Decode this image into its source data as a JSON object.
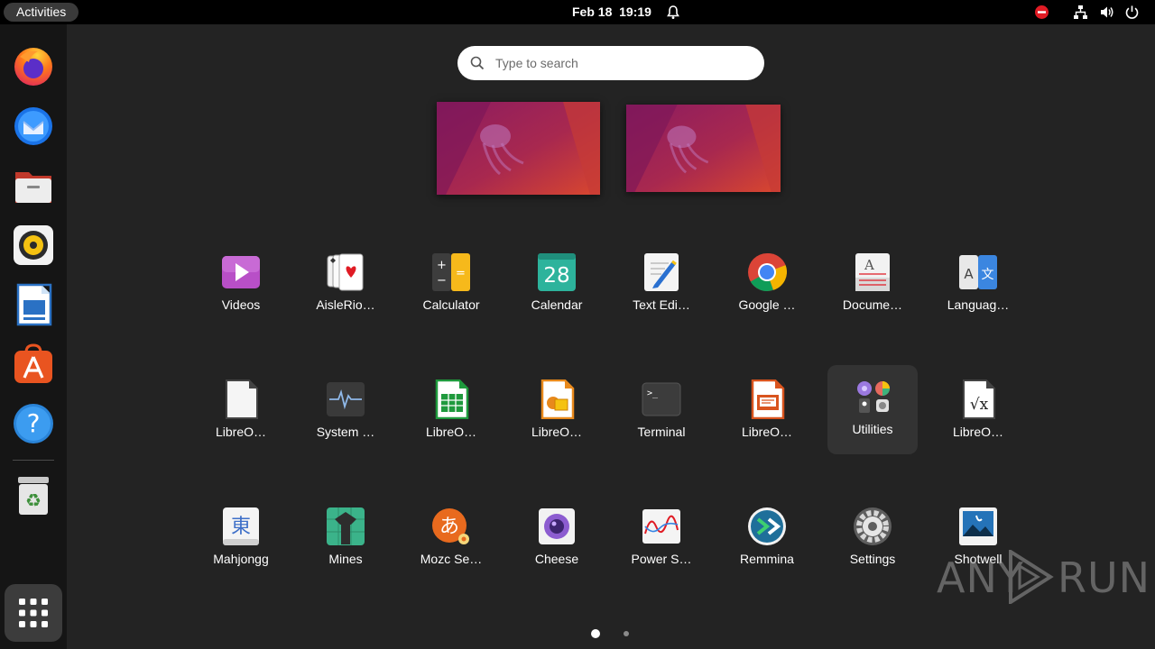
{
  "topbar": {
    "activities": "Activities",
    "date": "Feb 18",
    "time": "19:19"
  },
  "dock": {
    "items": [
      "firefox-icon",
      "thunderbird-icon",
      "files-icon",
      "rhythmbox-icon",
      "libreoffice-writer-icon",
      "app-center-icon",
      "help-icon",
      "trash-icon"
    ]
  },
  "search": {
    "placeholder": "Type to search"
  },
  "apps": [
    {
      "label": "Videos",
      "icon": "videos-icon"
    },
    {
      "label": "AisleRio…",
      "icon": "aisleriot-icon"
    },
    {
      "label": "Calculator",
      "icon": "calculator-icon"
    },
    {
      "label": "Calendar",
      "icon": "calendar-icon",
      "badge": "28"
    },
    {
      "label": "Text Edi…",
      "icon": "text-editor-icon"
    },
    {
      "label": "Google …",
      "icon": "chrome-icon"
    },
    {
      "label": "Docume…",
      "icon": "document-viewer-icon"
    },
    {
      "label": "Languag…",
      "icon": "language-icon",
      "glyph_a": "A",
      "glyph_b": "文"
    },
    {
      "label": "LibreO…",
      "icon": "libreoffice-icon"
    },
    {
      "label": "System …",
      "icon": "system-monitor-icon"
    },
    {
      "label": "LibreO…",
      "icon": "libreoffice-calc-icon"
    },
    {
      "label": "LibreO…",
      "icon": "libreoffice-draw-icon"
    },
    {
      "label": "Terminal",
      "icon": "terminal-icon",
      "prompt": ">_"
    },
    {
      "label": "LibreO…",
      "icon": "libreoffice-impress-icon"
    },
    {
      "label": "Utilities",
      "icon": "utilities-folder-icon"
    },
    {
      "label": "LibreO…",
      "icon": "libreoffice-math-icon",
      "formula": "√x"
    },
    {
      "label": "Mahjongg",
      "icon": "mahjongg-icon",
      "glyph": "東"
    },
    {
      "label": "Mines",
      "icon": "mines-icon"
    },
    {
      "label": "Mozc Se…",
      "icon": "mozc-icon",
      "glyph": "あ"
    },
    {
      "label": "Cheese",
      "icon": "cheese-icon"
    },
    {
      "label": "Power S…",
      "icon": "power-statistics-icon"
    },
    {
      "label": "Remmina",
      "icon": "remmina-icon"
    },
    {
      "label": "Settings",
      "icon": "settings-icon"
    },
    {
      "label": "Shotwell",
      "icon": "shotwell-icon"
    }
  ],
  "pages": {
    "count": 2,
    "current": 1
  },
  "watermark": {
    "left": "ANY",
    "right": "RUN"
  },
  "colors": {
    "accent": "#e95420",
    "panel": "#000000",
    "dock": "#151515",
    "overview": "#232323"
  }
}
